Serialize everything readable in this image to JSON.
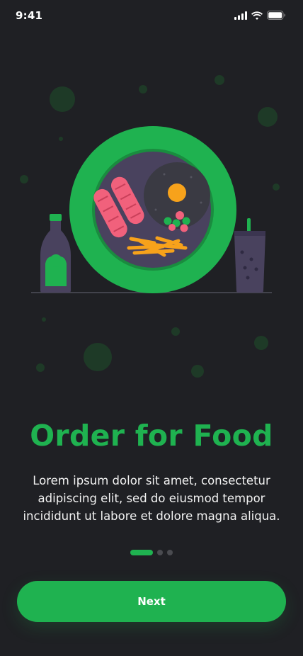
{
  "status_bar": {
    "time": "9:41",
    "icons": [
      "signal-icon",
      "wifi-icon",
      "battery-icon"
    ]
  },
  "onboarding": {
    "title": "Order for Food",
    "description": "Lorem ipsum dolor sit amet, consectetur adipiscing elit, sed do eiusmod tempor incididunt ut labore et dolore magna aliqua.",
    "page_indicator": {
      "total": 3,
      "current": 1
    },
    "next_label": "Next"
  },
  "colors": {
    "background": "#1f2024",
    "accent": "#1fb250",
    "text": "#ffffff"
  }
}
